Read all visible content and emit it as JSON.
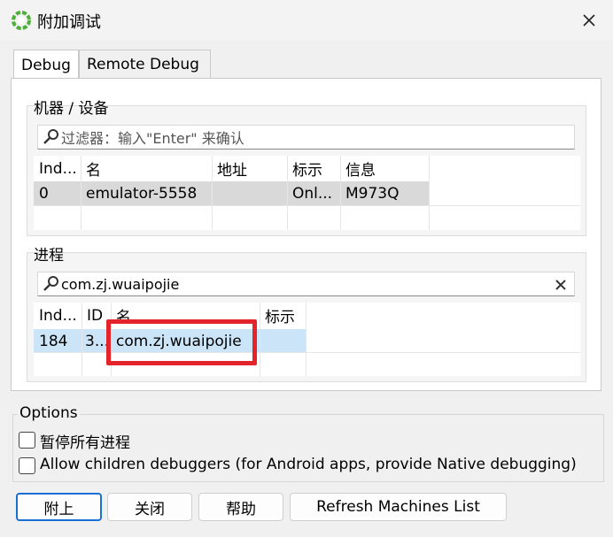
{
  "window": {
    "title": "附加调试",
    "app_icon": "gear-icon",
    "close_icon": "close-icon"
  },
  "tabs": [
    {
      "label": "Debug",
      "active": true
    },
    {
      "label": "Remote Debug",
      "active": false
    }
  ],
  "machines": {
    "group_label": "机器 / 设备",
    "filter_placeholder": "过滤器：输入\"Enter\" 来确认",
    "filter_value": "",
    "columns": [
      "Ind...",
      "名",
      "地址",
      "标示",
      "信息"
    ],
    "rows": [
      {
        "index": "0",
        "name": "emulator-5558",
        "address": "",
        "flag": "Onl...",
        "info": "M973Q"
      }
    ]
  },
  "processes": {
    "group_label": "进程",
    "filter_value": "com.zj.wuaipojie",
    "clear_icon": "clear-icon",
    "columns": [
      "Ind...",
      "ID",
      "名",
      "标示"
    ],
    "rows": [
      {
        "index": "184",
        "id": "3...",
        "name": "com.zj.wuaipojie",
        "flag": ""
      }
    ]
  },
  "options": {
    "label": "Options",
    "items": [
      {
        "label": "暂停所有进程",
        "checked": false
      },
      {
        "label": "Allow children debuggers (for Android apps, provide Native debugging)",
        "checked": false
      }
    ]
  },
  "buttons": {
    "attach": "附上",
    "close": "关闭",
    "help": "帮助",
    "refresh": "Refresh Machines List"
  },
  "colors": {
    "selection": "#cce4f7",
    "row_gray": "#d9d9d9",
    "highlight": "#e3242b",
    "default_button_border": "#1a6ed8"
  }
}
